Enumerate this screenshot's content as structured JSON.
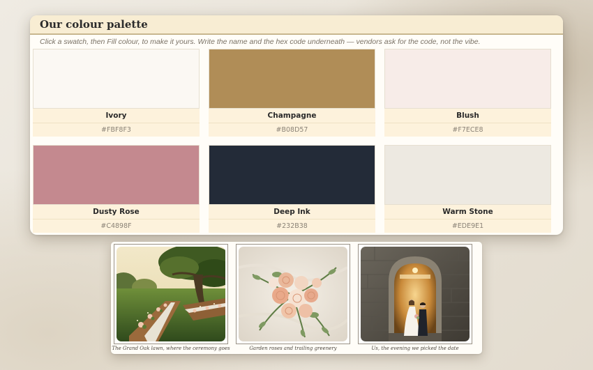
{
  "palette": {
    "title": "Our colour palette",
    "hint": "Click a swatch, then Fill colour, to make it yours. Write the name and the hex code underneath — vendors ask for the code, not the vibe.",
    "swatches": [
      {
        "name": "Ivory",
        "hex": "#FBF8F3",
        "color": "#FBF8F3"
      },
      {
        "name": "Champagne",
        "hex": "#B08D57",
        "color": "#B08D57"
      },
      {
        "name": "Blush",
        "hex": "#F7ECE8",
        "color": "#F7ECE8"
      },
      {
        "name": "Dusty Rose",
        "hex": "#C4898F",
        "color": "#C4898F"
      },
      {
        "name": "Deep Ink",
        "hex": "#232B38",
        "color": "#232B38"
      },
      {
        "name": "Warm Stone",
        "hex": "#EDE9E1",
        "color": "#EDE9E1"
      }
    ]
  },
  "photos": {
    "items": [
      {
        "caption": "The Grand Oak lawn, where the ceremony goes",
        "image": "garden-ceremony-tables-photo"
      },
      {
        "caption": "Garden roses and trailing greenery",
        "image": "bridal-bouquet-photo"
      },
      {
        "caption": "Us, the evening we picked the date",
        "image": "couple-in-stone-doorway-photo"
      }
    ]
  }
}
